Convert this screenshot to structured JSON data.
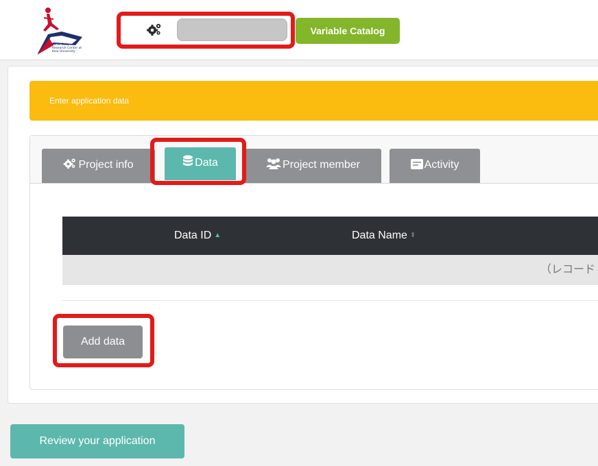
{
  "header": {
    "logo": {
      "text_lines": [
        "Panel Data",
        "Research Center at",
        "Keio University"
      ]
    },
    "settings_icon": "gears-icon",
    "search": {
      "value": "",
      "placeholder": ""
    },
    "variable_catalog_label": "Variable Catalog"
  },
  "alert": {
    "text": "Enter application data"
  },
  "tabs": [
    {
      "label": "Project info",
      "icon": "gears-icon",
      "active": false
    },
    {
      "label": "Data",
      "icon": "database-icon",
      "active": true
    },
    {
      "label": "Project member",
      "icon": "users-icon",
      "active": false
    },
    {
      "label": "Activity",
      "icon": "activity-icon",
      "active": false
    }
  ],
  "table": {
    "columns": [
      {
        "label": "Data ID",
        "sort": "ascending"
      },
      {
        "label": "Data Name",
        "sort": "none"
      }
    ],
    "empty_text": "（レコード"
  },
  "add_data_label": "Add data",
  "review_label": "Review your application",
  "colors": {
    "catalog_green": "#83b62a",
    "alert_yellow": "#fbbb0f",
    "teal": "#5cb8ad",
    "tab_gray": "#8e9093",
    "table_header": "#2e3236",
    "highlight_red": "#e31a1a"
  }
}
